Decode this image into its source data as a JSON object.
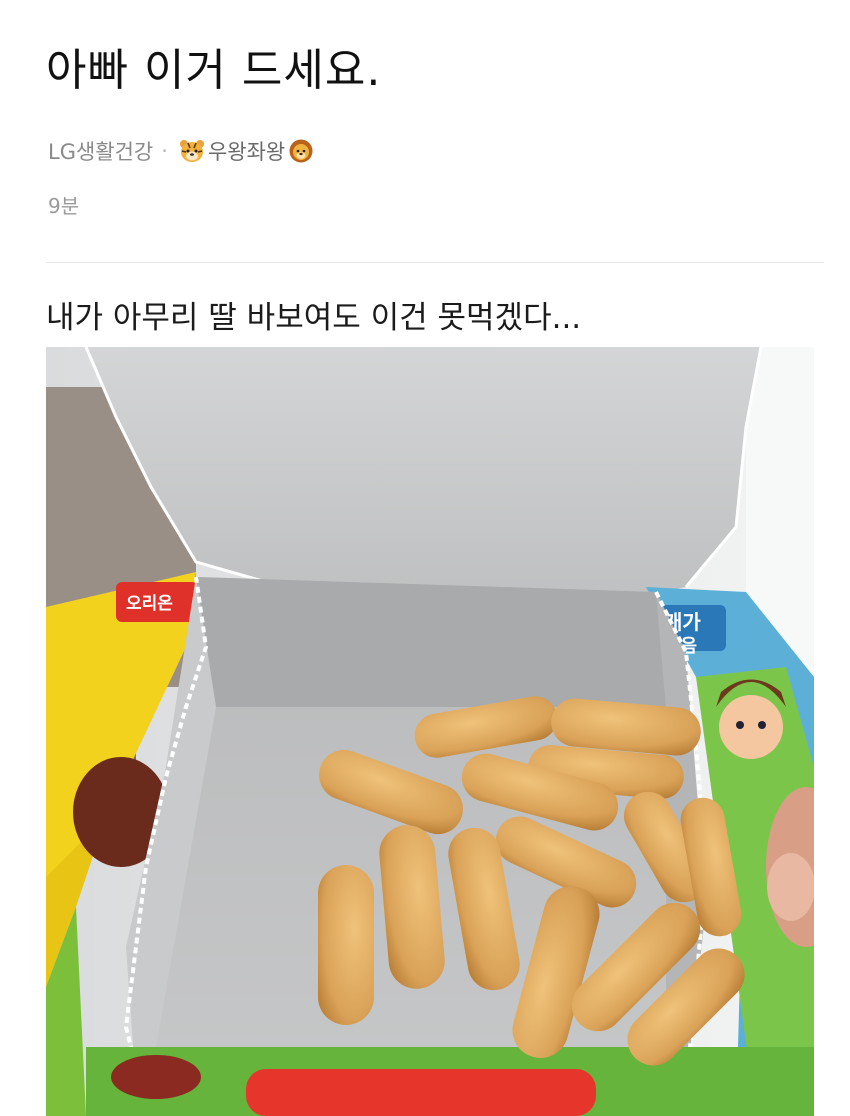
{
  "post": {
    "title": "아빠 이거 드세요.",
    "board": "LG생활건강",
    "separator": "·",
    "author": "우왕좌왕",
    "author_prefix_icon": "tiger-face-icon",
    "author_suffix_icon": "lion-face-icon",
    "time": "9분",
    "body": "내가 아무리 딸 바보여도 이건 못먹겠다...",
    "photo": {
      "description_icon": "photo",
      "box_brand_text": "오리온",
      "box_side_text_top": "개가",
      "box_side_text_bottom": "묶음"
    }
  },
  "colors": {
    "title": "#111111",
    "meta": "#8a8a8a",
    "divider": "#e6e6e6",
    "box_inner": "#c9cacb",
    "box_yellow": "#f2d21c",
    "biscuit": "#d9a35a"
  }
}
